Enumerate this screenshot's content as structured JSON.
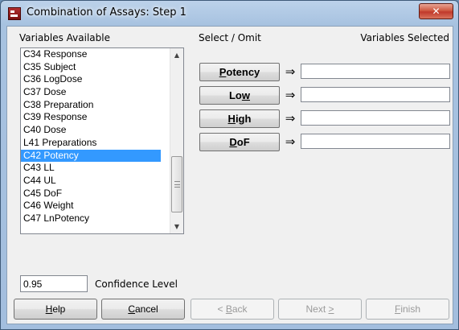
{
  "window": {
    "title": "Combination of Assays: Step 1",
    "close_glyph": "✕"
  },
  "labels": {
    "variables_available": "Variables Available",
    "select_omit": "Select / Omit",
    "variables_selected": "Variables Selected",
    "confidence_level": "Confidence Level"
  },
  "variables": [
    "C34 Response",
    "C35 Subject",
    "C36 LogDose",
    "C37 Dose",
    "C38 Preparation",
    "C39 Response",
    "C40 Dose",
    "L41 Preparations",
    "C42 Potency",
    "C43 LL",
    "C44 UL",
    "C45 DoF",
    "C46 Weight",
    "C47 LnPotency"
  ],
  "selected_variable": "C42 Potency",
  "select_buttons": [
    {
      "pre": "",
      "key": "P",
      "post": "otency"
    },
    {
      "pre": "Lo",
      "key": "w",
      "post": ""
    },
    {
      "pre": "",
      "key": "H",
      "post": "igh"
    },
    {
      "pre": "",
      "key": "D",
      "post": "oF"
    }
  ],
  "arrow_glyph": "⇒",
  "confidence_value": "0.95",
  "buttons": {
    "help": {
      "key": "H",
      "rest": "elp"
    },
    "cancel": {
      "key": "C",
      "rest": "ancel"
    },
    "back": {
      "pre": "< ",
      "key": "B",
      "rest": "ack"
    },
    "next": {
      "pre": "Next ",
      "key": ">",
      "rest": ""
    },
    "finish": {
      "key": "F",
      "rest": "inish"
    }
  },
  "colors": {
    "selection": "#3399ff",
    "close_button": "#c0392b"
  }
}
